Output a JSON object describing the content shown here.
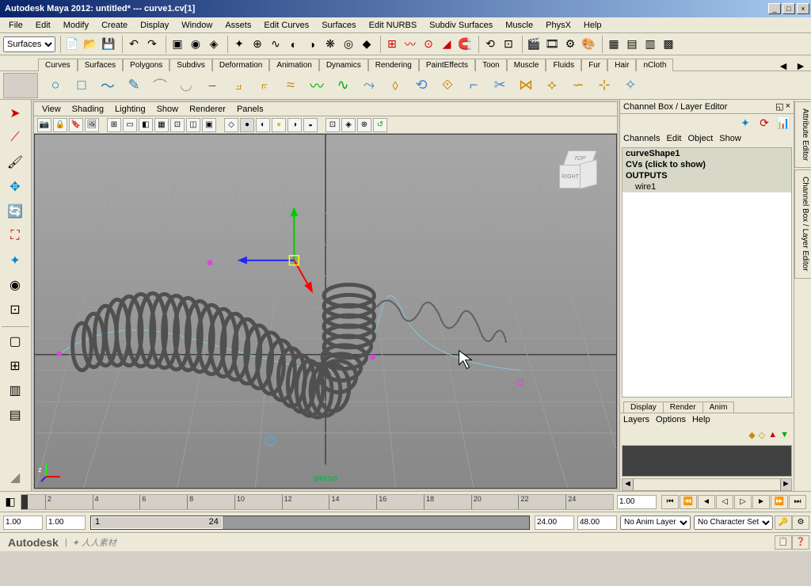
{
  "title": "Autodesk Maya 2012: untitled*  ---  curve1.cv[1]",
  "menubar": [
    "File",
    "Edit",
    "Modify",
    "Create",
    "Display",
    "Window",
    "Assets",
    "Edit Curves",
    "Surfaces",
    "Edit NURBS",
    "Subdiv Surfaces",
    "Muscle",
    "PhysX",
    "Help"
  ],
  "module_dropdown": "Surfaces",
  "shelf_tabs": [
    "Curves",
    "Surfaces",
    "Polygons",
    "Subdivs",
    "Deformation",
    "Animation",
    "Dynamics",
    "Rendering",
    "PaintEffects",
    "Toon",
    "Muscle",
    "Fluids",
    "Fur",
    "Hair",
    "nCloth"
  ],
  "view_menu": [
    "View",
    "Shading",
    "Lighting",
    "Show",
    "Renderer",
    "Panels"
  ],
  "channel_box_title": "Channel Box / Layer Editor",
  "cb_menu": [
    "Channels",
    "Edit",
    "Object",
    "Show"
  ],
  "cb_items": {
    "shape": "curveShape1",
    "cvs": "CVs (click to show)",
    "outputs": "OUTPUTS",
    "wire": "wire1"
  },
  "layer_tabs": [
    "Display",
    "Render",
    "Anim"
  ],
  "layer_menu": [
    "Layers",
    "Options",
    "Help"
  ],
  "side_tabs": [
    "Attribute Editor",
    "Channel Box / Layer Editor"
  ],
  "timeline": {
    "ticks": [
      "2",
      "4",
      "6",
      "8",
      "10",
      "12",
      "14",
      "16",
      "18",
      "20",
      "22",
      "24"
    ],
    "current": "1.00"
  },
  "range": {
    "start": "1.00",
    "in": "1.00",
    "cur1": "1",
    "out": "24",
    "end": "24.00",
    "end2": "48.00"
  },
  "anim_layer_sel": "No Anim Layer",
  "char_set_sel": "No Character Set",
  "brand": "Autodesk",
  "persp": "persp",
  "viewcube": {
    "top": "TOP",
    "right": "RIGHT"
  },
  "axis_z": "z"
}
